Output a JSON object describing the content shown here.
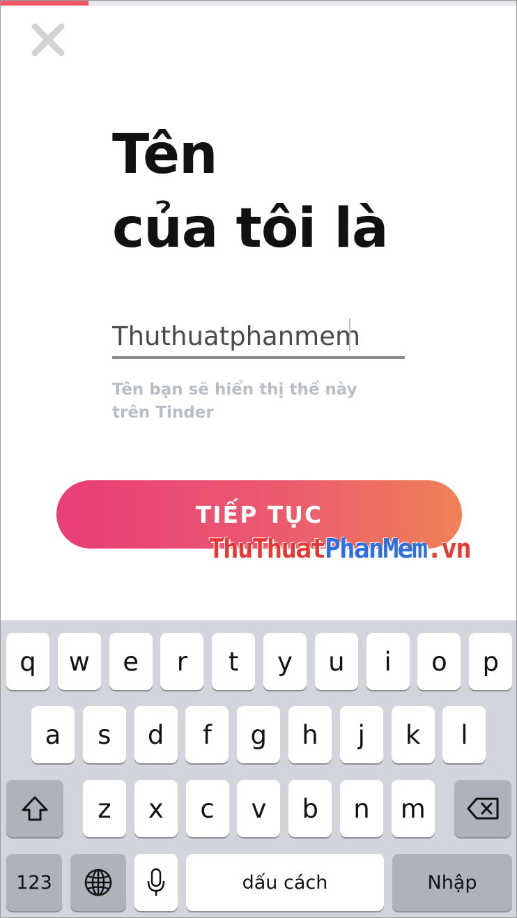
{
  "progress": {
    "value": 0.17,
    "color": "#f0566a"
  },
  "close_icon": "close-icon",
  "title": {
    "line1": "Tên",
    "line2": "của tôi là"
  },
  "name_input": {
    "value": "Thuthuatphanmem",
    "placeholder": ""
  },
  "hint": "Tên bạn sẽ hiển thị thế này trên Tinder",
  "continue_button": {
    "label": "TIẾP TỤC",
    "gradient": [
      "#e83e78",
      "#ef8157"
    ]
  },
  "watermark": {
    "part1": "ThuThuat",
    "part2": "PhanMem",
    "part3": ".vn"
  },
  "keyboard": {
    "row1": [
      "q",
      "w",
      "e",
      "r",
      "t",
      "y",
      "u",
      "i",
      "o",
      "p"
    ],
    "row2": [
      "a",
      "s",
      "d",
      "f",
      "g",
      "h",
      "j",
      "k",
      "l"
    ],
    "row3": [
      "z",
      "x",
      "c",
      "v",
      "b",
      "n",
      "m"
    ],
    "shift_icon": "shift-icon",
    "backspace_icon": "backspace-icon",
    "globe_icon": "globe-icon",
    "mic_icon": "microphone-icon",
    "numbers_label": "123",
    "space_label": "dấu cách",
    "return_label": "Nhập"
  }
}
